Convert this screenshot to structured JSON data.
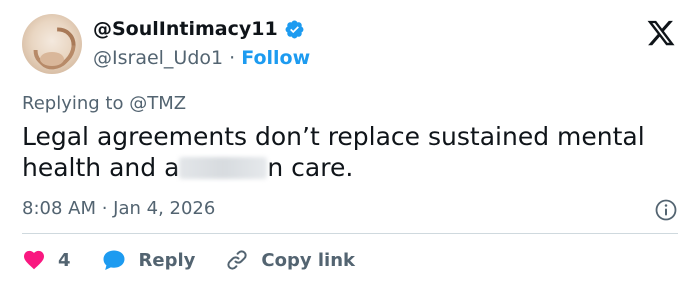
{
  "author": {
    "display_name": "@SoulIntimacy11",
    "handle": "@Israel_Udo1",
    "separator": "·",
    "follow_label": "Follow"
  },
  "tweet": {
    "replying_to": "Replying to @TMZ",
    "text_part1": "Legal agreements don’t replace sustained mental health and a",
    "text_part2": "n care.",
    "timestamp": "8:08 AM · Jan 4, 2026"
  },
  "actions": {
    "like_count": "4",
    "reply_label": "Reply",
    "copy_link_label": "Copy link"
  },
  "colors": {
    "accent": "#1d9bf0",
    "like": "#f91880",
    "text": "#0f1419",
    "muted": "#536471"
  },
  "icons": [
    "verified-badge-icon",
    "x-logo-icon",
    "info-icon",
    "heart-icon",
    "reply-bubble-icon",
    "link-icon"
  ]
}
